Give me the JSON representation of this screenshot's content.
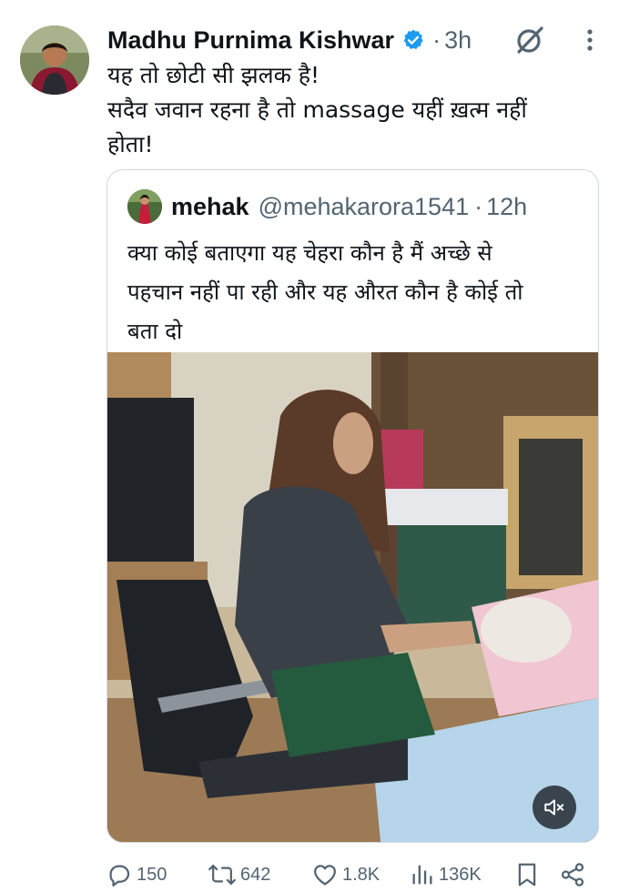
{
  "post": {
    "author_name": "Madhu Purnima Kishwar",
    "separator": "·",
    "time": "3h",
    "text_lines": [
      "यह तो छोटी सी झलक है!",
      "सदैव जवान रहना है तो  massage यहीं ख़त्म नहीं",
      "होता!"
    ]
  },
  "quote": {
    "author_name": "mehak",
    "handle": "@mehakarora1541",
    "separator": "·",
    "time": "12h",
    "text_lines": [
      "क्या कोई बताएगा यह चेहरा कौन है मैं अच्छे से",
      "पहचान नहीं पा रही और यह औरत कौन है कोई तो",
      "बता दो"
    ]
  },
  "actions": {
    "replies": "150",
    "reposts": "642",
    "likes": "1.8K",
    "views": "136K"
  },
  "icons": {
    "verified": "verified-badge-icon",
    "grok": "grok-icon",
    "more": "more-icon",
    "mute": "volume-muted-icon",
    "reply": "reply-icon",
    "repost": "repost-icon",
    "like": "heart-icon",
    "views": "views-icon",
    "bookmark": "bookmark-icon",
    "share": "share-icon"
  },
  "colors": {
    "verified": "#1d9bf0",
    "text": "#0f1419",
    "secondary": "#536471",
    "border": "#cfd9de"
  }
}
